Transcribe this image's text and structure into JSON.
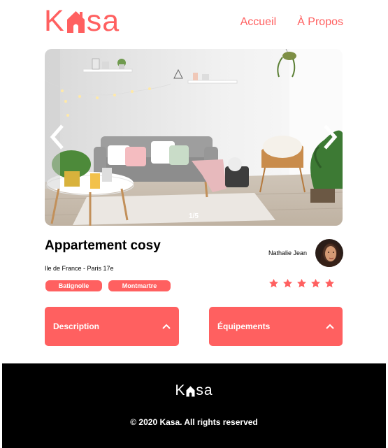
{
  "brand": {
    "logo_letters": [
      "K",
      "sa"
    ],
    "color": "#FF6060"
  },
  "nav": {
    "home": "Accueil",
    "about": "À Propos"
  },
  "gallery": {
    "counter": "1/5",
    "prev_icon": "chevron-left-icon",
    "next_icon": "chevron-right-icon"
  },
  "listing": {
    "title": "Appartement cosy",
    "location": "Ile de France - Paris 17e",
    "tags": [
      "Batignolle",
      "Montmartre"
    ],
    "rating": 5,
    "rating_max": 5
  },
  "host": {
    "name": "Nathalie Jean"
  },
  "collapses": [
    {
      "label": "Description",
      "icon": "chevron-up-icon"
    },
    {
      "label": "Équipements",
      "icon": "chevron-up-icon"
    }
  ],
  "footer": {
    "logo_letters": [
      "K",
      "sa"
    ],
    "copyright": "© 2020 Kasa. All rights reserved"
  }
}
